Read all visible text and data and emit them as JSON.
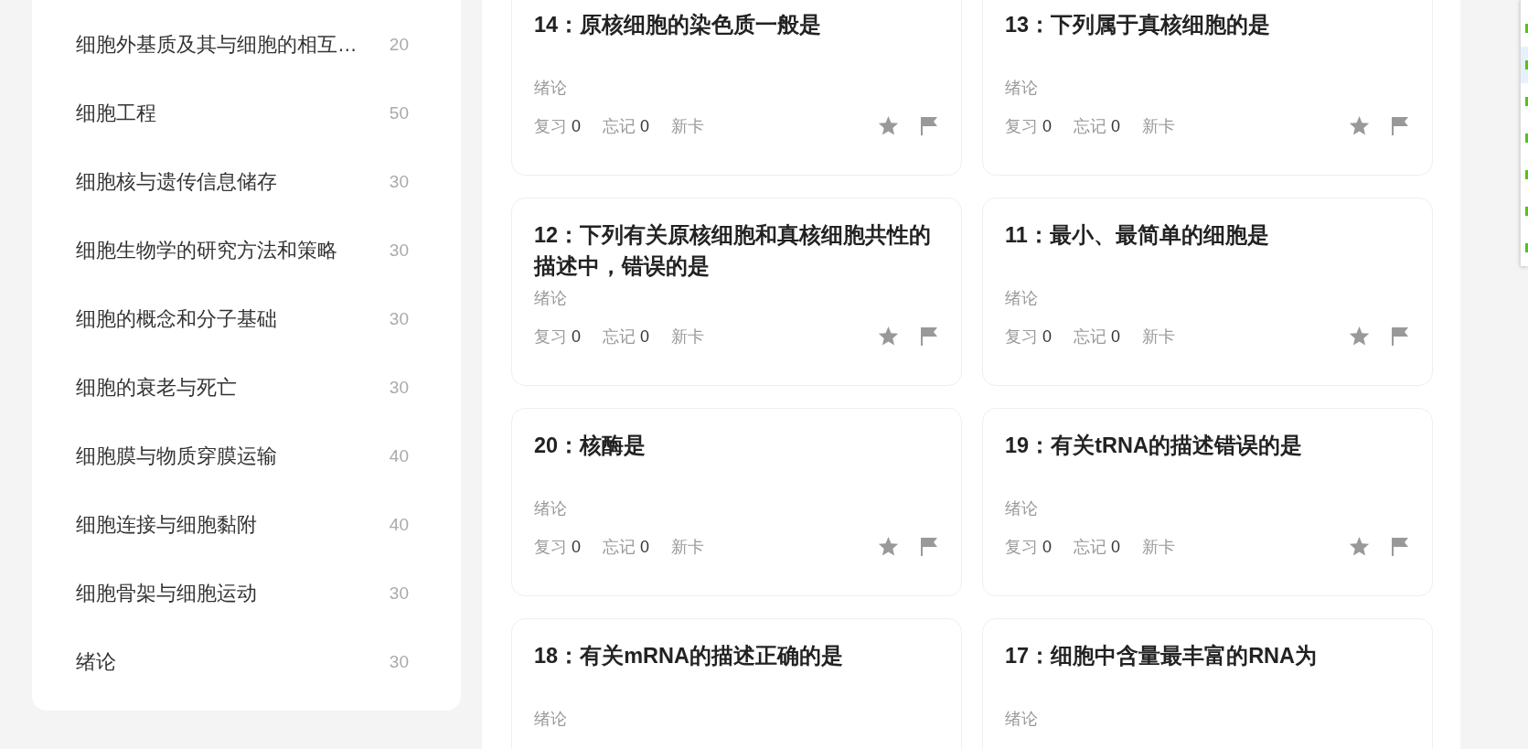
{
  "sidebar": {
    "items": [
      {
        "label": "细胞外基质及其与细胞的相互…",
        "count": "20"
      },
      {
        "label": "细胞工程",
        "count": "50"
      },
      {
        "label": "细胞核与遗传信息储存",
        "count": "30"
      },
      {
        "label": "细胞生物学的研究方法和策略",
        "count": "30"
      },
      {
        "label": "细胞的概念和分子基础",
        "count": "30"
      },
      {
        "label": "细胞的衰老与死亡",
        "count": "30"
      },
      {
        "label": "细胞膜与物质穿膜运输",
        "count": "40"
      },
      {
        "label": "细胞连接与细胞黏附",
        "count": "40"
      },
      {
        "label": "细胞骨架与细胞运动",
        "count": "30"
      },
      {
        "label": "绪论",
        "count": "30"
      }
    ]
  },
  "cards": [
    {
      "title": "14：原核细胞的染色质一般是",
      "subject": "绪论",
      "review": {
        "label": "复习",
        "count": "0"
      },
      "forget": {
        "label": "忘记",
        "count": "0"
      },
      "status": "新卡",
      "starred": false,
      "flagged": false
    },
    {
      "title": "13：下列属于真核细胞的是",
      "subject": "绪论",
      "review": {
        "label": "复习",
        "count": "0"
      },
      "forget": {
        "label": "忘记",
        "count": "0"
      },
      "status": "新卡",
      "starred": false,
      "flagged": false
    },
    {
      "title": "12：下列有关原核细胞和真核细胞共性的描述中，错误的是",
      "subject": "绪论",
      "review": {
        "label": "复习",
        "count": "0"
      },
      "forget": {
        "label": "忘记",
        "count": "0"
      },
      "status": "新卡",
      "starred": false,
      "flagged": false
    },
    {
      "title": "11：最小、最简单的细胞是",
      "subject": "绪论",
      "review": {
        "label": "复习",
        "count": "0"
      },
      "forget": {
        "label": "忘记",
        "count": "0"
      },
      "status": "新卡",
      "starred": false,
      "flagged": false
    },
    {
      "title": "20：核酶是",
      "subject": "绪论",
      "review": {
        "label": "复习",
        "count": "0"
      },
      "forget": {
        "label": "忘记",
        "count": "0"
      },
      "status": "新卡",
      "starred": false,
      "flagged": false
    },
    {
      "title": "19：有关tRNA的描述错误的是",
      "subject": "绪论",
      "review": {
        "label": "复习",
        "count": "0"
      },
      "forget": {
        "label": "忘记",
        "count": "0"
      },
      "status": "新卡",
      "starred": false,
      "flagged": false
    },
    {
      "title": "18：有关mRNA的描述正确的是",
      "subject": "绪论"
    },
    {
      "title": "17：细胞中含量最丰富的RNA为",
      "subject": "绪论"
    }
  ],
  "side_menu": {
    "items": [
      {
        "selected": false
      },
      {
        "selected": true
      },
      {
        "selected": false
      },
      {
        "selected": false
      },
      {
        "selected": false
      },
      {
        "selected": false
      },
      {
        "selected": false
      }
    ]
  }
}
